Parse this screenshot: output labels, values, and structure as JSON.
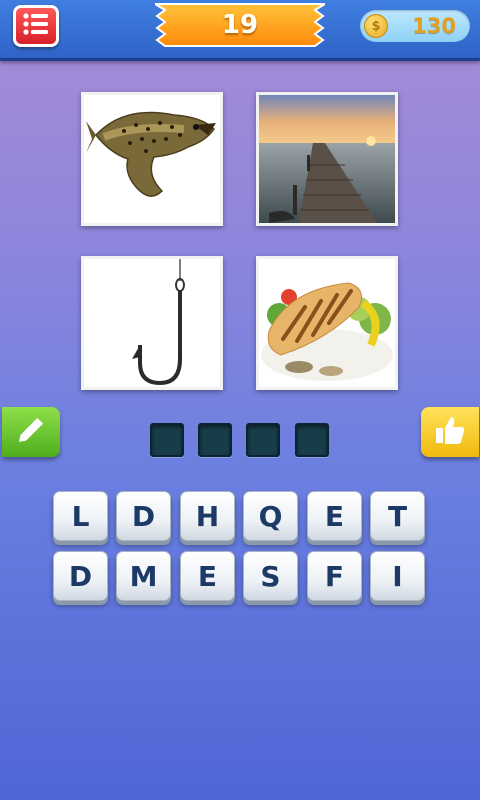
{
  "header": {
    "level": "19",
    "coins": "130",
    "coin_symbol": "$"
  },
  "puzzle": {
    "images": [
      {
        "subject": "trout"
      },
      {
        "subject": "pier at sunset"
      },
      {
        "subject": "fishing hook"
      },
      {
        "subject": "grilled fish plate"
      }
    ],
    "answer_slots": [
      "",
      "",
      "",
      ""
    ]
  },
  "keyboard": {
    "row1": [
      "L",
      "D",
      "H",
      "Q",
      "E",
      "T"
    ],
    "row2": [
      "D",
      "M",
      "E",
      "S",
      "F",
      "I"
    ]
  },
  "icons": {
    "menu": "list-menu-icon",
    "coin": "coin-icon",
    "hint": "pencil-icon",
    "share": "thumbs-up-icon"
  },
  "colors": {
    "menu_button": "#e0303a",
    "level_badge": "#ff9d17",
    "hint_button": "#5dbf24",
    "share_button": "#f5c51b",
    "slot": "#173c4a",
    "key_text": "#1d3a66"
  }
}
